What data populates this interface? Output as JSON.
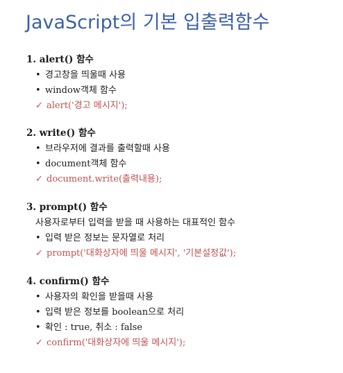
{
  "title": "JavaScript의 기본 입출력함수",
  "sections": [
    {
      "heading": "1. alert() 함수",
      "bullets": [
        "경고창을 띄울때 사용",
        "window객체 함수"
      ],
      "check": "alert('경고 메시지');"
    },
    {
      "heading": "2. write() 함수",
      "bullets": [
        "브라우저에 결과를 출력할때 사용",
        "document객체 함수"
      ],
      "check": "document.write(출력내용);"
    },
    {
      "heading": "3. prompt() 함수",
      "intro": "사용자로부터 입력을 받을 때 사용하는 대표적인 함수",
      "bullets": [
        "입력 받은 정보는 문자열로 처리"
      ],
      "check": "prompt('대화상자에 띄울 메시지', '기본설정값');"
    },
    {
      "heading": "4. confirm() 함수",
      "bullets": [
        "사용자의 확인을 받을때 사용",
        "입력 받은 정보를 boolean으로 처리",
        "확인 : true, 취소 : false"
      ],
      "check": "confirm('대화상자에 띄울 메시지');"
    }
  ],
  "colors": {
    "title": "#3b5fa8",
    "code": "#c0504d"
  },
  "icons": {
    "bullet": "•",
    "check": "✓"
  }
}
